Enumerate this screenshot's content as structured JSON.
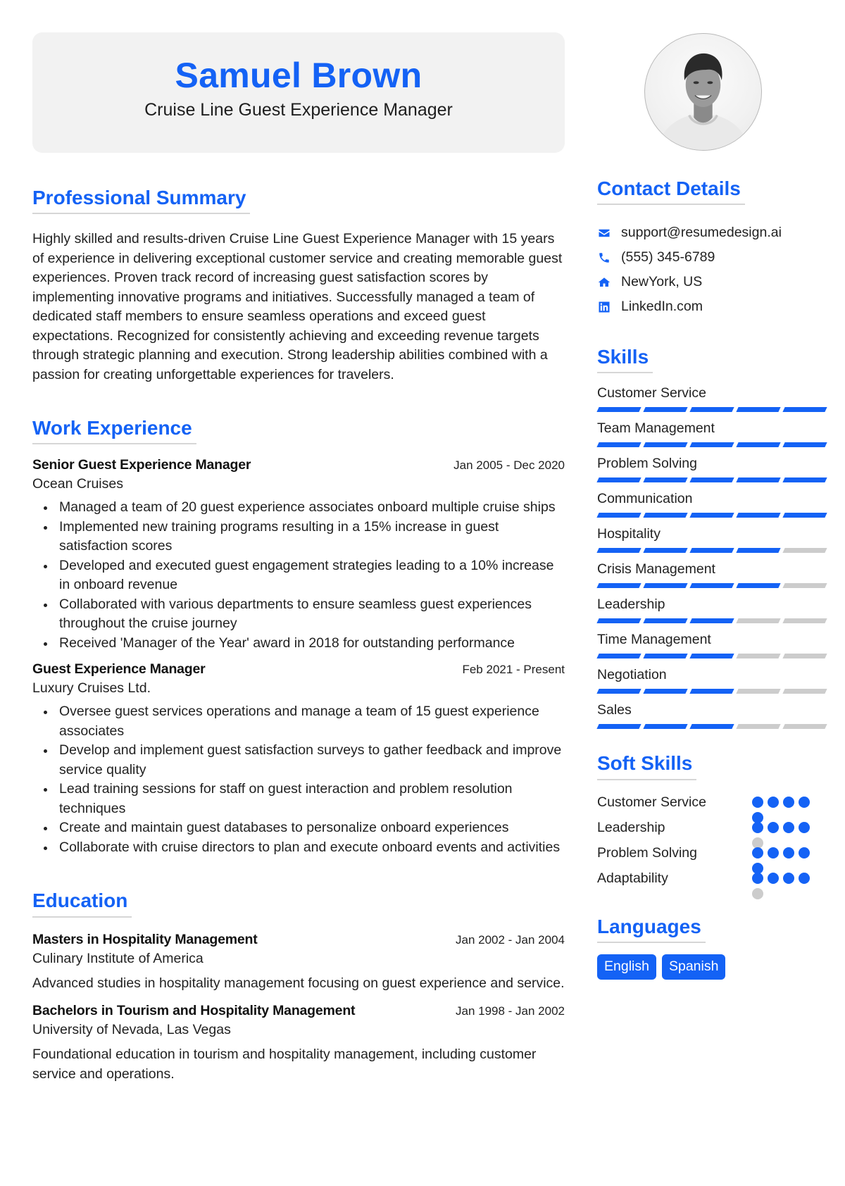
{
  "header": {
    "name": "Samuel Brown",
    "title": "Cruise Line Guest Experience Manager"
  },
  "photo": {
    "alt": "profile-photo"
  },
  "summary": {
    "heading": "Professional Summary",
    "text": "Highly skilled and results-driven Cruise Line Guest Experience Manager with 15 years of experience in delivering exceptional customer service and creating memorable guest experiences. Proven track record of increasing guest satisfaction scores by implementing innovative programs and initiatives. Successfully managed a team of dedicated staff members to ensure seamless operations and exceed guest expectations. Recognized for consistently achieving and exceeding revenue targets through strategic planning and execution. Strong leadership abilities combined with a passion for creating unforgettable experiences for travelers."
  },
  "experience": {
    "heading": "Work Experience",
    "jobs": [
      {
        "title": "Senior Guest Experience Manager",
        "dates": "Jan 2005 - Dec 2020",
        "company": "Ocean Cruises",
        "bullets": [
          "Managed a team of 20 guest experience associates onboard multiple cruise ships",
          "Implemented new training programs resulting in a 15% increase in guest satisfaction scores",
          "Developed and executed guest engagement strategies leading to a 10% increase in onboard revenue",
          "Collaborated with various departments to ensure seamless guest experiences throughout the cruise journey",
          "Received 'Manager of the Year' award in 2018 for outstanding performance"
        ]
      },
      {
        "title": "Guest Experience Manager",
        "dates": "Feb 2021 - Present",
        "company": "Luxury Cruises Ltd.",
        "bullets": [
          "Oversee guest services operations and manage a team of 15 guest experience associates",
          "Develop and implement guest satisfaction surveys to gather feedback and improve service quality",
          "Lead training sessions for staff on guest interaction and problem resolution techniques",
          "Create and maintain guest databases to personalize onboard experiences",
          "Collaborate with cruise directors to plan and execute onboard events and activities"
        ]
      }
    ]
  },
  "education": {
    "heading": "Education",
    "items": [
      {
        "degree": "Masters in Hospitality Management",
        "dates": "Jan 2002 - Jan 2004",
        "school": "Culinary Institute of America",
        "description": "Advanced studies in hospitality management focusing on guest experience and service."
      },
      {
        "degree": "Bachelors in Tourism and Hospitality Management",
        "dates": "Jan 1998 - Jan 2002",
        "school": "University of Nevada, Las Vegas",
        "description": "Foundational education in tourism and hospitality management, including customer service and operations."
      }
    ]
  },
  "contact": {
    "heading": "Contact Details",
    "items": [
      {
        "icon": "envelope-icon",
        "text": "support@resumedesign.ai"
      },
      {
        "icon": "phone-icon",
        "text": "(555) 345-6789"
      },
      {
        "icon": "home-icon",
        "text": "NewYork, US"
      },
      {
        "icon": "linkedin-icon",
        "text": "LinkedIn.com"
      }
    ]
  },
  "skills": {
    "heading": "Skills",
    "scale_max": 5,
    "items": [
      {
        "name": "Customer Service",
        "level": 5
      },
      {
        "name": "Team Management",
        "level": 5
      },
      {
        "name": "Problem Solving",
        "level": 5
      },
      {
        "name": "Communication",
        "level": 5
      },
      {
        "name": "Hospitality",
        "level": 4
      },
      {
        "name": "Crisis Management",
        "level": 4
      },
      {
        "name": "Leadership",
        "level": 3
      },
      {
        "name": "Time Management",
        "level": 3
      },
      {
        "name": "Negotiation",
        "level": 3
      },
      {
        "name": "Sales",
        "level": 3
      }
    ]
  },
  "soft_skills": {
    "heading": "Soft Skills",
    "scale_max": 5,
    "items": [
      {
        "name": "Customer Service",
        "level": 5
      },
      {
        "name": "Leadership",
        "level": 4
      },
      {
        "name": "Problem Solving",
        "level": 5
      },
      {
        "name": "Adaptability",
        "level": 4
      }
    ]
  },
  "languages": {
    "heading": "Languages",
    "items": [
      "English",
      "Spanish"
    ]
  },
  "colors": {
    "accent": "#1462f5",
    "inactive": "#cccccc",
    "header_bg": "#f2f2f2"
  }
}
